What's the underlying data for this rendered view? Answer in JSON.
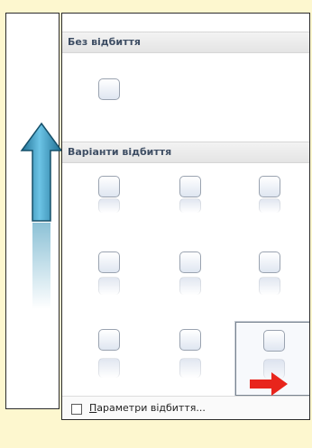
{
  "gallery": {
    "section_none": "Без відбиття",
    "section_variants": "Варіанти відбиття",
    "footer_accel": "П",
    "footer_rest": "араметри відбиття...",
    "grip": "....",
    "selected_index": 8
  },
  "colors": {
    "page_bg": "#fdf7cf",
    "arrow_blue": "#2f8fb5",
    "arrow_red": "#e8251c"
  },
  "icons": [
    "up-arrow-icon",
    "red-pointer-arrow-icon",
    "checkbox"
  ]
}
